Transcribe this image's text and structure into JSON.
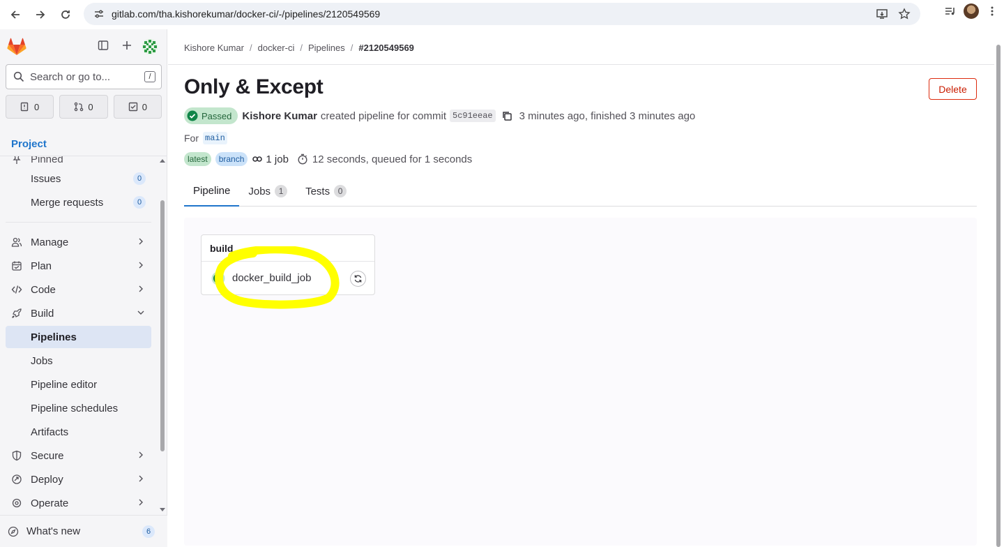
{
  "browser": {
    "url": "gitlab.com/tha.kishorekumar/docker-ci/-/pipelines/2120549569"
  },
  "sidebar": {
    "search_placeholder": "Search or go to...",
    "search_shortcut": "/",
    "counters": {
      "issues": "0",
      "merge_requests": "0",
      "todos": "0"
    },
    "project_label": "Project",
    "pinned_label": "Pinned",
    "items": [
      {
        "label": "Issues",
        "badge": "0"
      },
      {
        "label": "Merge requests",
        "badge": "0"
      },
      {
        "label": "Manage"
      },
      {
        "label": "Plan"
      },
      {
        "label": "Code"
      },
      {
        "label": "Build"
      },
      {
        "label": "Pipelines"
      },
      {
        "label": "Jobs"
      },
      {
        "label": "Pipeline editor"
      },
      {
        "label": "Pipeline schedules"
      },
      {
        "label": "Artifacts"
      },
      {
        "label": "Secure"
      },
      {
        "label": "Deploy"
      },
      {
        "label": "Operate"
      }
    ],
    "whats_new": {
      "label": "What's new",
      "badge": "6"
    }
  },
  "breadcrumb": [
    "Kishore Kumar",
    "docker-ci",
    "Pipelines",
    "#2120549569"
  ],
  "page": {
    "title": "Only & Except",
    "delete_label": "Delete",
    "status": "Passed",
    "author": "Kishore Kumar",
    "created_text": "created pipeline for commit",
    "commit_sha": "5c91eeae",
    "time_text": "3 minutes ago, finished 3 minutes ago",
    "for_label": "For",
    "ref": "main",
    "tags": [
      "latest",
      "branch"
    ],
    "job_count": "1 job",
    "duration": "12 seconds, queued for 1 seconds"
  },
  "tabs": [
    {
      "label": "Pipeline"
    },
    {
      "label": "Jobs",
      "count": "1"
    },
    {
      "label": "Tests",
      "count": "0"
    }
  ],
  "graph": {
    "stage": "build",
    "job": "docker_build_job"
  },
  "colors": {
    "accent": "#1f75cb",
    "success": "#108548",
    "danger": "#dd2b0e",
    "highlight": "#ffff00"
  }
}
